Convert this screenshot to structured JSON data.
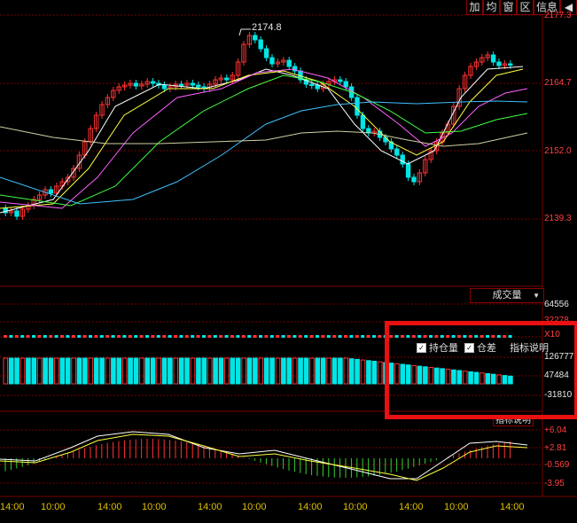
{
  "toolbar": [
    {
      "label": "加"
    },
    {
      "label": "均"
    },
    {
      "label": "窗"
    },
    {
      "label": "区"
    },
    {
      "label": "信息"
    },
    {
      "label": "◀"
    }
  ],
  "price_axis": [
    "2177.3",
    "2164.7",
    "2152.0",
    "2139.3"
  ],
  "peak_label": "2174.8",
  "volume_selector": {
    "label": "成交量"
  },
  "volume_axis": [
    "64556",
    "32278"
  ],
  "volume_multiplier": "X10",
  "open_interest": {
    "checkbox1_label": "持仓量",
    "checkbox2_label": "仓差",
    "help_label": "指标说明",
    "axis": [
      "126777",
      "47484",
      "-31810"
    ]
  },
  "macd": {
    "help_label": "指标说明",
    "axis": [
      "+6.04",
      "+2.81",
      "-0.569",
      "-3.95"
    ]
  },
  "time_axis": [
    "14:00",
    "10:00",
    "14:00",
    "10:00",
    "14:00",
    "10:00",
    "14:00",
    "10:00",
    "14:00",
    "10:00",
    "14:00"
  ],
  "colors": {
    "up": "#ff3232",
    "down": "#00e6e6",
    "grid": "#7a0000",
    "time_text": "#e0c000",
    "highlight": "#e81010"
  }
}
